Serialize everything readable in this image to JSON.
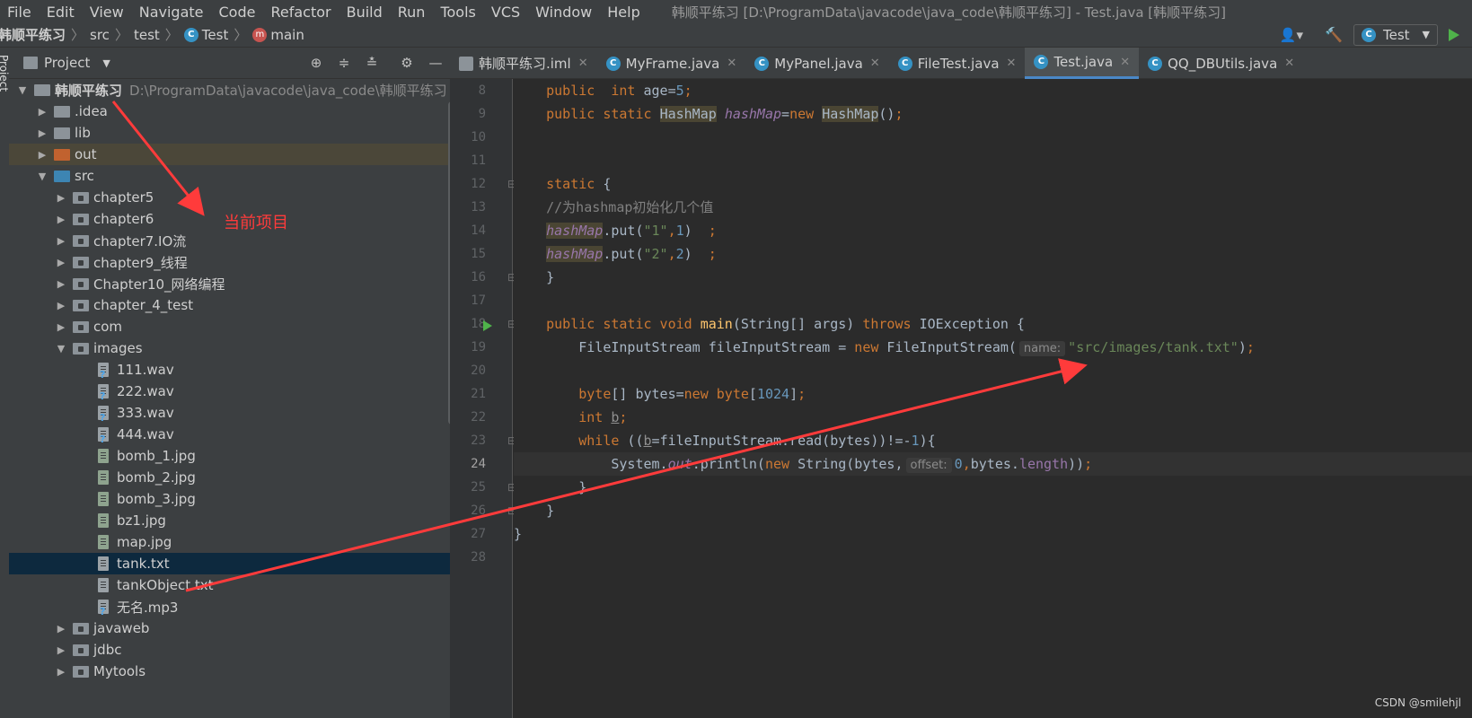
{
  "menu": [
    "File",
    "Edit",
    "View",
    "Navigate",
    "Code",
    "Refactor",
    "Build",
    "Run",
    "Tools",
    "VCS",
    "Window",
    "Help"
  ],
  "window_title": "韩顺平练习 [D:\\ProgramData\\javacode\\java_code\\韩顺平练习] - Test.java [韩顺平练习]",
  "breadcrumb": [
    "韩顺平练习",
    "src",
    "test",
    "Test",
    "main"
  ],
  "run_config": "Test",
  "project_panel": {
    "title": "Project",
    "side_label": "Project"
  },
  "tree": [
    {
      "label": "韩顺平练习",
      "path": "D:\\ProgramData\\javacode\\java_code\\韩顺平练习"
    },
    {
      "label": ".idea"
    },
    {
      "label": "lib"
    },
    {
      "label": "out"
    },
    {
      "label": "src"
    },
    {
      "label": "chapter5"
    },
    {
      "label": "chapter6"
    },
    {
      "label": "chapter7.IO流"
    },
    {
      "label": "chapter9_线程"
    },
    {
      "label": "Chapter10_网络编程"
    },
    {
      "label": "chapter_4_test"
    },
    {
      "label": "com"
    },
    {
      "label": "images"
    },
    {
      "label": "111.wav"
    },
    {
      "label": "222.wav"
    },
    {
      "label": "333.wav"
    },
    {
      "label": "444.wav"
    },
    {
      "label": "bomb_1.jpg"
    },
    {
      "label": "bomb_2.jpg"
    },
    {
      "label": "bomb_3.jpg"
    },
    {
      "label": "bz1.jpg"
    },
    {
      "label": "map.jpg"
    },
    {
      "label": "tank.txt"
    },
    {
      "label": "tankObject.txt"
    },
    {
      "label": "无名.mp3"
    },
    {
      "label": "javaweb"
    },
    {
      "label": "jdbc"
    },
    {
      "label": "Mytools"
    }
  ],
  "tabs": [
    "韩顺平练习.iml",
    "MyFrame.java",
    "MyPanel.java",
    "FileTest.java",
    "Test.java",
    "QQ_DBUtils.java"
  ],
  "active_tab": "Test.java",
  "line_numbers": [
    "8",
    "9",
    "10",
    "11",
    "12",
    "13",
    "14",
    "15",
    "16",
    "17",
    "18",
    "19",
    "20",
    "21",
    "22",
    "23",
    "24",
    "25",
    "26",
    "27",
    "28"
  ],
  "code": {
    "l8_kw": "public",
    "l8_kw2": "int",
    "l8_var": "age",
    "l8_num": "5",
    "l9_kw": "public static",
    "l9_type": "HashMap",
    "l9_field": "hashMap",
    "l9_new": "new",
    "l12_kw": "static",
    "l13_comment": "//为hashmap初始化几个值",
    "l14_key": "\"1\"",
    "l14_val": "1",
    "l15_key": "\"2\"",
    "l15_val": "2",
    "put": "put",
    "l18_kw": "public static void",
    "l18_fn": "main",
    "l18_params": "(String[] args)",
    "l18_throws": "throws",
    "l18_exc": "IOException {",
    "l19_decl": "FileInputStream fileInputStream = ",
    "l19_ctor": "FileInputStream(",
    "l19_hint": "name:",
    "l19_str": "\"src/images/tank.txt\"",
    "l21_kw": "byte",
    "l21_num": "1024",
    "l22_kw": "int",
    "l22_var": "b",
    "l23_kw": "while",
    "l23_rest": "fileInputStream.read(bytes))!=-",
    "l23_num": "1",
    "l24_sys": "System.",
    "l24_out": "out",
    "l24_print": ".println(",
    "l24_new": "new",
    "l24_str": "String(bytes,",
    "l24_hint": "offset:",
    "l24_num": "0",
    "l24_len": "length",
    "brace": "}"
  },
  "annotation_note": "当前项目",
  "watermark": "CSDN @smilehjl",
  "colors": {
    "annotation": "#ff3b3b",
    "accent": "#4a88c7",
    "selection": "#0d293e"
  }
}
